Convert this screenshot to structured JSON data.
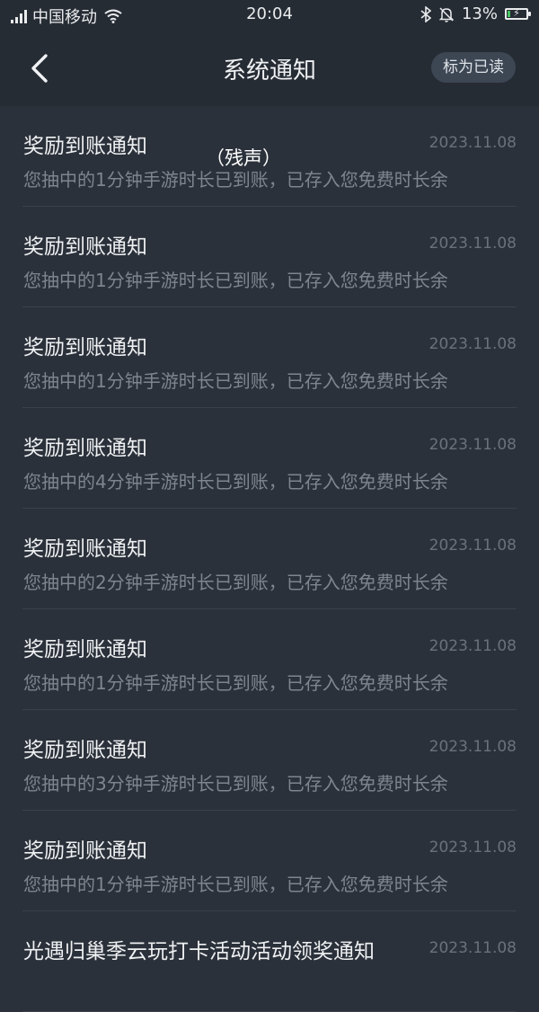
{
  "status_bar": {
    "carrier": "中国移动",
    "time": "20:04",
    "battery_percent": "13%",
    "battery_level": 0.13,
    "icons": [
      "signal-icon",
      "wifi-icon",
      "bluetooth-icon",
      "mute-bell-icon",
      "battery-icon"
    ]
  },
  "header": {
    "title": "系统通知",
    "mark_read_label": "标为已读",
    "back_icon": "chevron-left-icon"
  },
  "overlay_note": "（残声）",
  "notifications": [
    {
      "title": "奖励到账通知",
      "date": "2023.11.08",
      "body": "您抽中的1分钟手游时长已到账，已存入您免费时长余"
    },
    {
      "title": "奖励到账通知",
      "date": "2023.11.08",
      "body": "您抽中的1分钟手游时长已到账，已存入您免费时长余"
    },
    {
      "title": "奖励到账通知",
      "date": "2023.11.08",
      "body": "您抽中的1分钟手游时长已到账，已存入您免费时长余"
    },
    {
      "title": "奖励到账通知",
      "date": "2023.11.08",
      "body": "您抽中的4分钟手游时长已到账，已存入您免费时长余"
    },
    {
      "title": "奖励到账通知",
      "date": "2023.11.08",
      "body": "您抽中的2分钟手游时长已到账，已存入您免费时长余"
    },
    {
      "title": "奖励到账通知",
      "date": "2023.11.08",
      "body": "您抽中的1分钟手游时长已到账，已存入您免费时长余"
    },
    {
      "title": "奖励到账通知",
      "date": "2023.11.08",
      "body": "您抽中的3分钟手游时长已到账，已存入您免费时长余"
    },
    {
      "title": "奖励到账通知",
      "date": "2023.11.08",
      "body": "您抽中的1分钟手游时长已到账，已存入您免费时长余"
    },
    {
      "title": "光遇归巢季云玩打卡活动活动领奖通知",
      "date": "2023.11.08",
      "body": ""
    }
  ],
  "colors": {
    "background": "#2b313a",
    "header_background": "#262c34",
    "button_background": "#3d4754",
    "title_text": "#eef0f2",
    "body_text": "#7d858f",
    "date_text": "#69727c",
    "battery_fill": "#46c460"
  }
}
